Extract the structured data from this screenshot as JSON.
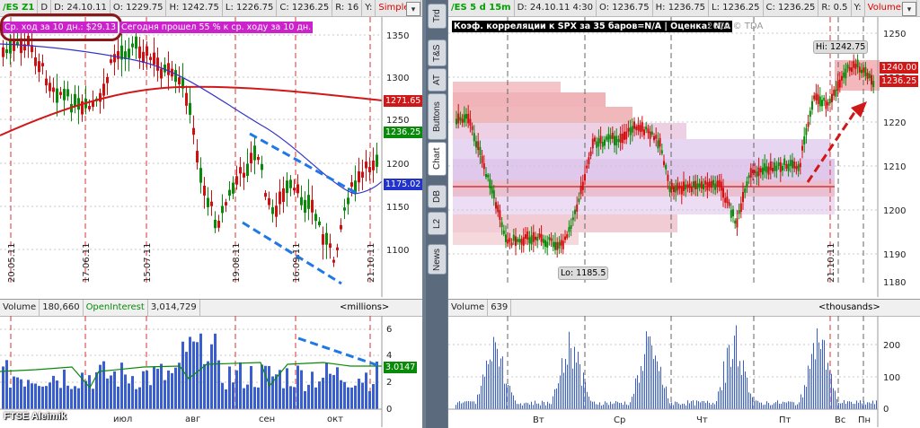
{
  "left": {
    "header": {
      "symbol": "/ES Z1 ",
      "interval": "D",
      "date": "D: 24.10.11",
      "open": "O: 1229.75",
      "high": "H: 1242.75",
      "low": "L: 1226.75",
      "close": "C: 1236.25",
      "range": "R: 16",
      "extra": "Y:",
      "study": "Simple..."
    },
    "avg_move": "Ср. ход за 10 дн.: $29.13",
    "today_text": "Сегодня прошел 55 % к ср. ходу за 10 дн.",
    "price_axis": [
      "1350",
      "1300",
      "1250",
      "1200",
      "1150",
      "1100"
    ],
    "price_tags": {
      "ma_red": "1271.65",
      "last": "1236.25",
      "ma_blue": "1175.02"
    },
    "date_labels": [
      "20.05.11",
      "17.06.11",
      "15.07.11",
      "19.08.11",
      "16.09.11",
      "21.10.11"
    ],
    "volume_header": {
      "label": "Volume",
      "value": "180,660",
      "oi_label": "OpenInterest",
      "oi_value": "3,014,729",
      "unit": "<millions>"
    },
    "volume_axis": [
      "6",
      "4",
      "2",
      "0"
    ],
    "oi_tag": "3.0147",
    "months": [
      "июл",
      "авг",
      "сен",
      "окт"
    ],
    "watermark": "FTSE  Aleimik"
  },
  "sidebar": [
    "Trd",
    "T&S",
    "AT",
    "Buttons",
    "Chart",
    "DB",
    "L2",
    "News"
  ],
  "right": {
    "header": {
      "symbol": "/ES 5 d 15m",
      "date": "D: 24.10.11 4:30",
      "open": "O: 1236.75",
      "high": "H: 1236.75",
      "low": "L: 1236.25",
      "close": "C: 1236.25",
      "range": "R: 0.5",
      "extra": "Y:",
      "study": "VolumeP..."
    },
    "corr_text": "Коэф. корреляции к SPX за 35 баров=N/A | Оценка: N/A",
    "copyright": "2010 © TDA",
    "hi_label": "Hi: 1242.75",
    "lo_label": "Lo: 1185.5",
    "price_axis": [
      "1250",
      "1240",
      "1230",
      "1220",
      "1210",
      "1200",
      "1190",
      "1180"
    ],
    "price_tags": {
      "upper": "1240.00",
      "last": "1236.25"
    },
    "date_label": "21.10.11",
    "volume_header": {
      "label": "Volume",
      "value": "639",
      "unit": "<thousands>"
    },
    "volume_axis": [
      "200",
      "100",
      "0"
    ],
    "days": [
      "Вт",
      "Ср",
      "Чт",
      "Пт",
      "Вс",
      "Пн"
    ]
  },
  "colors": {
    "bull": "#0a8a0a",
    "bear": "#d01010",
    "ma_red": "#d01818",
    "ma_blue": "#3333cc",
    "trend": "#1e78e6"
  }
}
